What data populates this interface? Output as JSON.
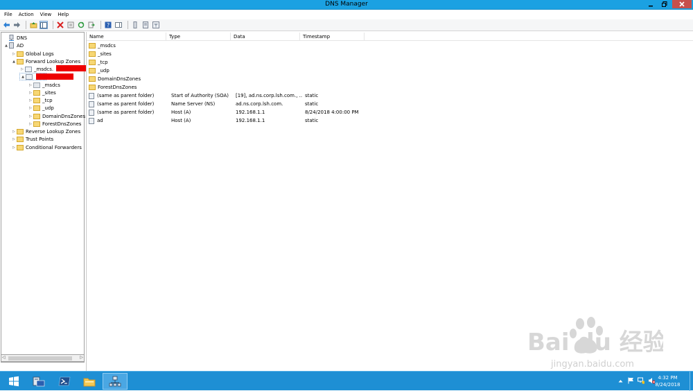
{
  "window": {
    "title": "DNS Manager"
  },
  "menu": [
    "File",
    "Action",
    "View",
    "Help"
  ],
  "tree": [
    {
      "label": "DNS",
      "level": 0,
      "icon": "dns-server-icon",
      "expander": ""
    },
    {
      "label": "AD",
      "level": 1,
      "icon": "server-icon",
      "expander": "▲"
    },
    {
      "label": "Global Logs",
      "level": 2,
      "icon": "folder-icon",
      "expander": "▷"
    },
    {
      "label": "Forward Lookup Zones",
      "level": 2,
      "icon": "folder-icon",
      "expander": "▲"
    },
    {
      "label": "_msdcs.",
      "level": 3,
      "icon": "zone-icon",
      "expander": "▷"
    },
    {
      "label": "",
      "level": 3,
      "icon": "zone-icon",
      "expander": "▲"
    },
    {
      "label": "_msdcs",
      "level": 4,
      "icon": "folder-icon",
      "expander": "▷"
    },
    {
      "label": "_sites",
      "level": 4,
      "icon": "folder-icon",
      "expander": "▷"
    },
    {
      "label": "_tcp",
      "level": 4,
      "icon": "folder-icon",
      "expander": "▷"
    },
    {
      "label": "_udp",
      "level": 4,
      "icon": "folder-icon",
      "expander": "▷"
    },
    {
      "label": "DomainDnsZones",
      "level": 4,
      "icon": "folder-icon",
      "expander": "▷"
    },
    {
      "label": "ForestDnsZones",
      "level": 4,
      "icon": "folder-icon",
      "expander": "▷"
    },
    {
      "label": "Reverse Lookup Zones",
      "level": 2,
      "icon": "folder-icon",
      "expander": "▷"
    },
    {
      "label": "Trust Points",
      "level": 2,
      "icon": "folder-icon",
      "expander": "▷"
    },
    {
      "label": "Conditional Forwarders",
      "level": 2,
      "icon": "folder-icon",
      "expander": "▷"
    }
  ],
  "columns": [
    "Name",
    "Type",
    "Data",
    "Timestamp"
  ],
  "records": [
    {
      "name": "_msdcs",
      "type": "",
      "data": "",
      "timestamp": "",
      "icon": "folder"
    },
    {
      "name": "_sites",
      "type": "",
      "data": "",
      "timestamp": "",
      "icon": "folder"
    },
    {
      "name": "_tcp",
      "type": "",
      "data": "",
      "timestamp": "",
      "icon": "folder"
    },
    {
      "name": "_udp",
      "type": "",
      "data": "",
      "timestamp": "",
      "icon": "folder"
    },
    {
      "name": "DomainDnsZones",
      "type": "",
      "data": "",
      "timestamp": "",
      "icon": "folder"
    },
    {
      "name": "ForestDnsZones",
      "type": "",
      "data": "",
      "timestamp": "",
      "icon": "folder"
    },
    {
      "name": "(same as parent folder)",
      "type": "Start of Authority (SOA)",
      "data": "[19], ad.ns.corp.lsh.com., ...",
      "timestamp": "static",
      "icon": "record"
    },
    {
      "name": "(same as parent folder)",
      "type": "Name Server (NS)",
      "data": "ad.ns.corp.lsh.com.",
      "timestamp": "static",
      "icon": "record"
    },
    {
      "name": "(same as parent folder)",
      "type": "Host (A)",
      "data": "192.168.1.1",
      "timestamp": "8/24/2018 4:00:00 PM",
      "icon": "record"
    },
    {
      "name": "ad",
      "type": "Host (A)",
      "data": "192.168.1.1",
      "timestamp": "static",
      "icon": "record"
    }
  ],
  "taskbar": {
    "time": "4:32 PM",
    "date": "8/24/2018"
  },
  "watermark": {
    "brand": "Bai du 经验",
    "url": "jingyan.baidu.com"
  },
  "colors": {
    "titlebar": "#1ba1e2",
    "taskbar": "#1e8fd4",
    "redaction": "#ee0000"
  }
}
